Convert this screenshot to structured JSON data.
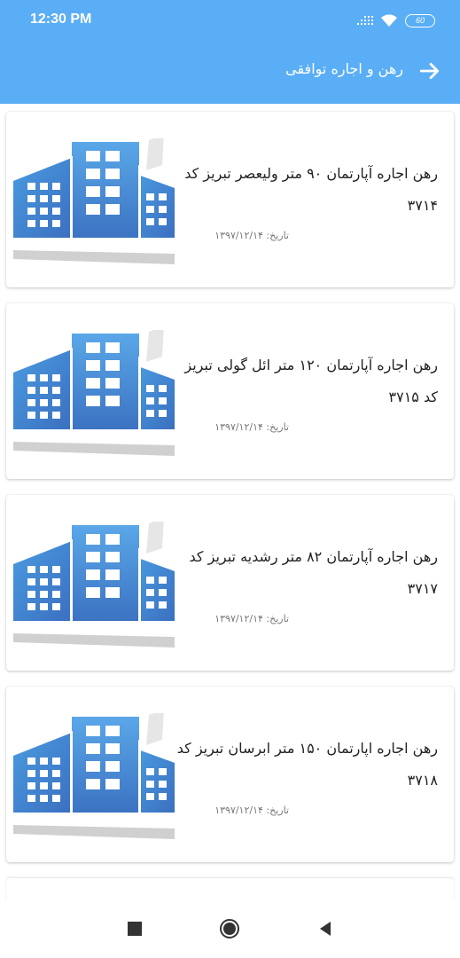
{
  "status_bar": {
    "time": "12:30 PM",
    "battery": "60",
    "icons": [
      "signal-icon",
      "wifi-icon",
      "battery-icon"
    ]
  },
  "toolbar": {
    "title": "رهن و اجاره توافقی",
    "back_icon": "arrow-forward-icon",
    "color": "#5aaef5"
  },
  "listings": [
    {
      "title": "رهن اجاره آپارتمان ۹۰ متر ولیعصر تبریز  کد ۳۷۱۴",
      "date": "تاریخ:  ۱۳۹۷/۱۲/۱۴",
      "icon": "building-icon"
    },
    {
      "title": "رهن اجاره آپارتمان ۱۲۰ متر ائل گولی تبریز  کد ۳۷۱۵",
      "date": "تاریخ:  ۱۳۹۷/۱۲/۱۴",
      "icon": "building-icon"
    },
    {
      "title": "رهن اجاره آپارتمان ۸۲ متر رشدیه تبریز  کد ۳۷۱۷",
      "date": "تاریخ:  ۱۳۹۷/۱۲/۱۴",
      "icon": "building-icon"
    },
    {
      "title": "رهن اجاره اپارتمان ۱۵۰ متر ابرسان تبریز  کد ۳۷۱۸",
      "date": "تاریخ:  ۱۳۹۷/۱۲/۱۴",
      "icon": "building-icon"
    }
  ],
  "nav_bar": {
    "buttons": [
      "recents-square-icon",
      "home-circle-icon",
      "back-triangle-icon"
    ]
  }
}
